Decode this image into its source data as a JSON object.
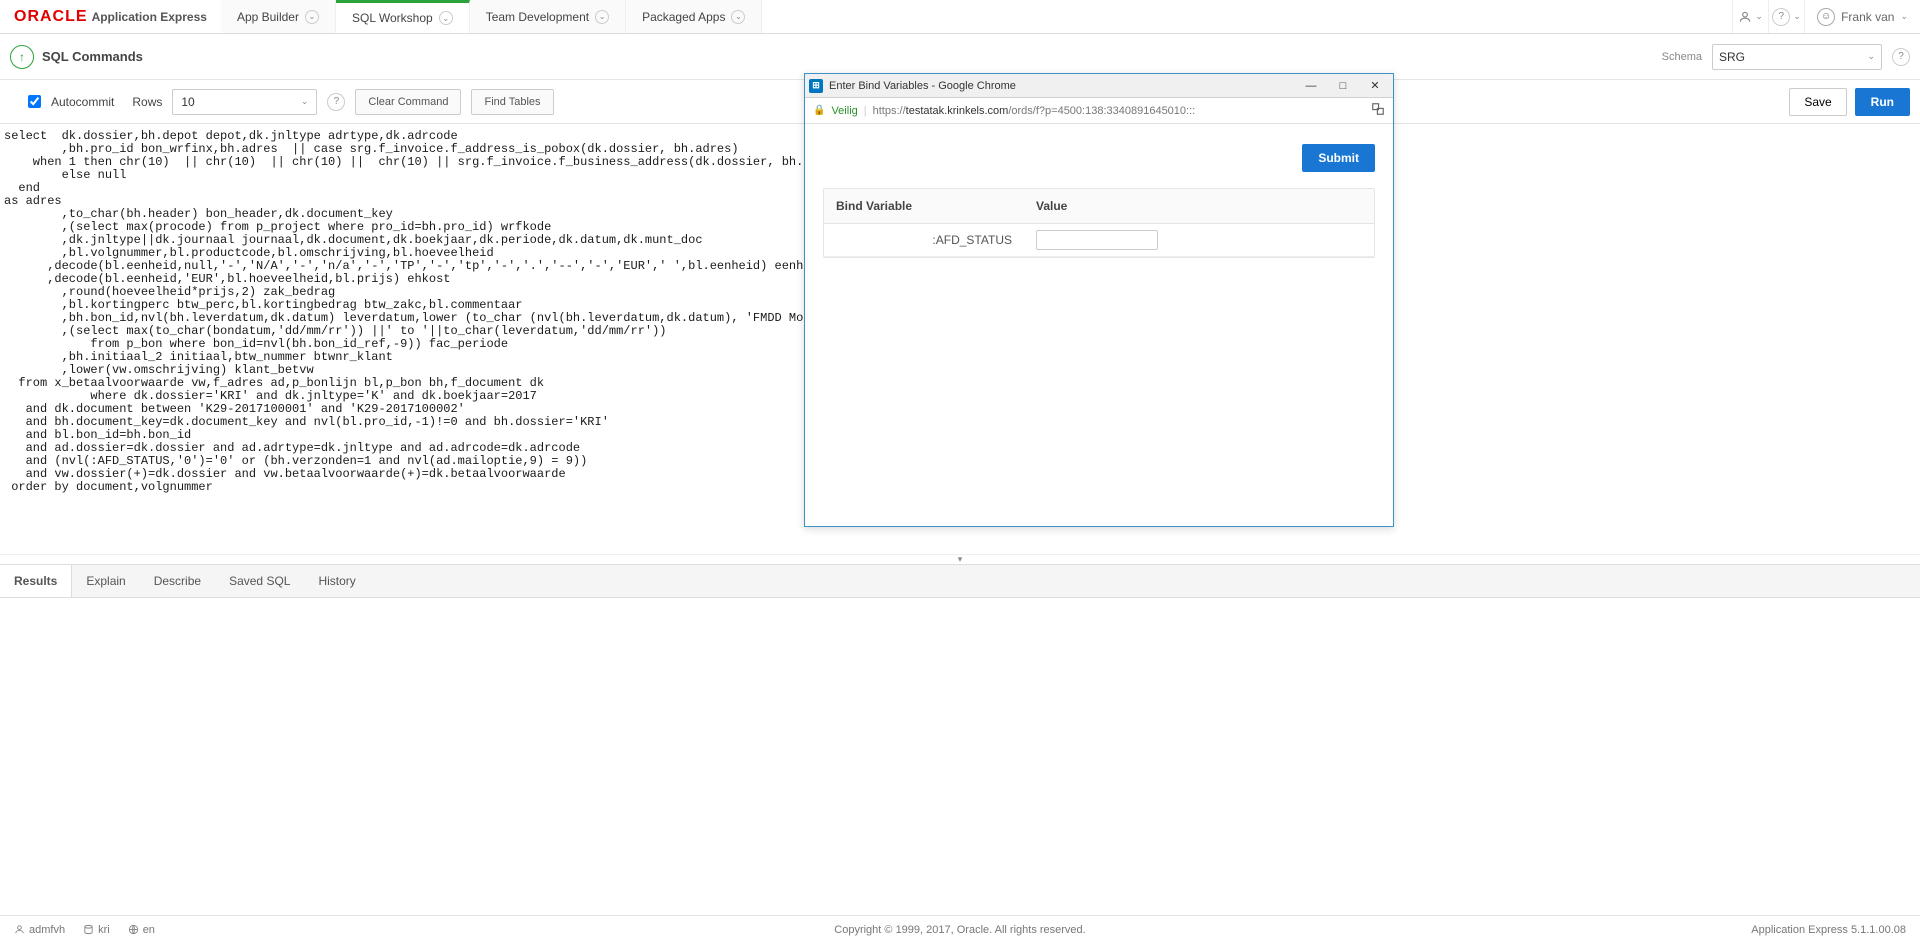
{
  "brand": {
    "oracle": "ORACLE",
    "apex": "Application Express"
  },
  "nav": {
    "app_builder": "App Builder",
    "sql_workshop": "SQL Workshop",
    "team_dev": "Team Development",
    "packaged": "Packaged Apps"
  },
  "user": {
    "name": "Frank van"
  },
  "subheader": {
    "title": "SQL Commands",
    "schema_label": "Schema",
    "schema_value": "SRG"
  },
  "toolbar": {
    "autocommit": "Autocommit",
    "rows_label": "Rows",
    "rows_value": "10",
    "clear": "Clear Command",
    "find": "Find Tables",
    "save": "Save",
    "run": "Run"
  },
  "editor_text": "select  dk.dossier,bh.depot depot,dk.jnltype adrtype,dk.adrcode\n        ,bh.pro_id bon_wrfinx,bh.adres  || case srg.f_invoice.f_address_is_pobox(dk.dossier, bh.adres)\n    when 1 then chr(10)  || chr(10)  || chr(10) ||  chr(10) || srg.f_invoice.f_business_address(dk.dossier, bh.adrtype, dk.adrcode)\n        else null\n  end\nas adres\n        ,to_char(bh.header) bon_header,dk.document_key\n        ,(select max(procode) from p_project where pro_id=bh.pro_id) wrfkode\n        ,dk.jnltype||dk.journaal journaal,dk.document,dk.boekjaar,dk.periode,dk.datum,dk.munt_doc\n        ,bl.volgnummer,bl.productcode,bl.omschrijving,bl.hoeveelheid\n      ,decode(bl.eenheid,null,'-','N/A','-','n/a','-','TP','-','tp','-','.','--','-','EUR',' ',bl.eenheid) eenheid\n      ,decode(bl.eenheid,'EUR',bl.hoeveelheid,bl.prijs) ehkost\n        ,round(hoeveelheid*prijs,2) zak_bedrag\n        ,bl.kortingperc btw_perc,bl.kortingbedrag btw_zakc,bl.commentaar\n        ,bh.bon_id,nvl(bh.leverdatum,dk.datum) leverdatum,lower (to_char (nvl(bh.leverdatum,dk.datum), 'FMDD Month RRRR','nls_date_language=english')) leverdatum_txt\n        ,(select max(to_char(bondatum,'dd/mm/rr')) ||' to '||to_char(leverdatum,'dd/mm/rr'))\n            from p_bon where bon_id=nvl(bh.bon_id_ref,-9)) fac_periode\n        ,bh.initiaal_2 initiaal,btw_nummer btwnr_klant\n        ,lower(vw.omschrijving) klant_betvw\n  from x_betaalvoorwaarde vw,f_adres ad,p_bonlijn bl,p_bon bh,f_document dk\n            where dk.dossier='KRI' and dk.jnltype='K' and dk.boekjaar=2017\n   and dk.document between 'K29-2017100001' and 'K29-2017100002'\n   and bh.document_key=dk.document_key and nvl(bl.pro_id,-1)!=0 and bh.dossier='KRI'\n   and bl.bon_id=bh.bon_id\n   and ad.dossier=dk.dossier and ad.adrtype=dk.jnltype and ad.adrcode=dk.adrcode\n   and (nvl(:AFD_STATUS,'0')='0' or (bh.verzonden=1 and nvl(ad.mailoptie,9) = 9))\n   and vw.dossier(+)=dk.dossier and vw.betaalvoorwaarde(+)=dk.betaalvoorwaarde\n order by document,volgnummer",
  "result_tabs": {
    "results": "Results",
    "explain": "Explain",
    "describe": "Describe",
    "saved": "Saved SQL",
    "history": "History"
  },
  "footer": {
    "user": "admfvh",
    "workspace": "kri",
    "lang": "en",
    "copyright": "Copyright © 1999, 2017, Oracle. All rights reserved.",
    "version": "Application Express 5.1.1.00.08"
  },
  "popup": {
    "title": "Enter Bind Variables - Google Chrome",
    "secure": "Veilig",
    "url_prefix": "https://",
    "url_host": "testatak.krinkels.com",
    "url_path": "/ords/f?p=4500:138:3340891645010:::",
    "submit": "Submit",
    "col_bind": "Bind Variable",
    "col_value": "Value",
    "bind_name": ":AFD_STATUS",
    "bind_value": ""
  }
}
